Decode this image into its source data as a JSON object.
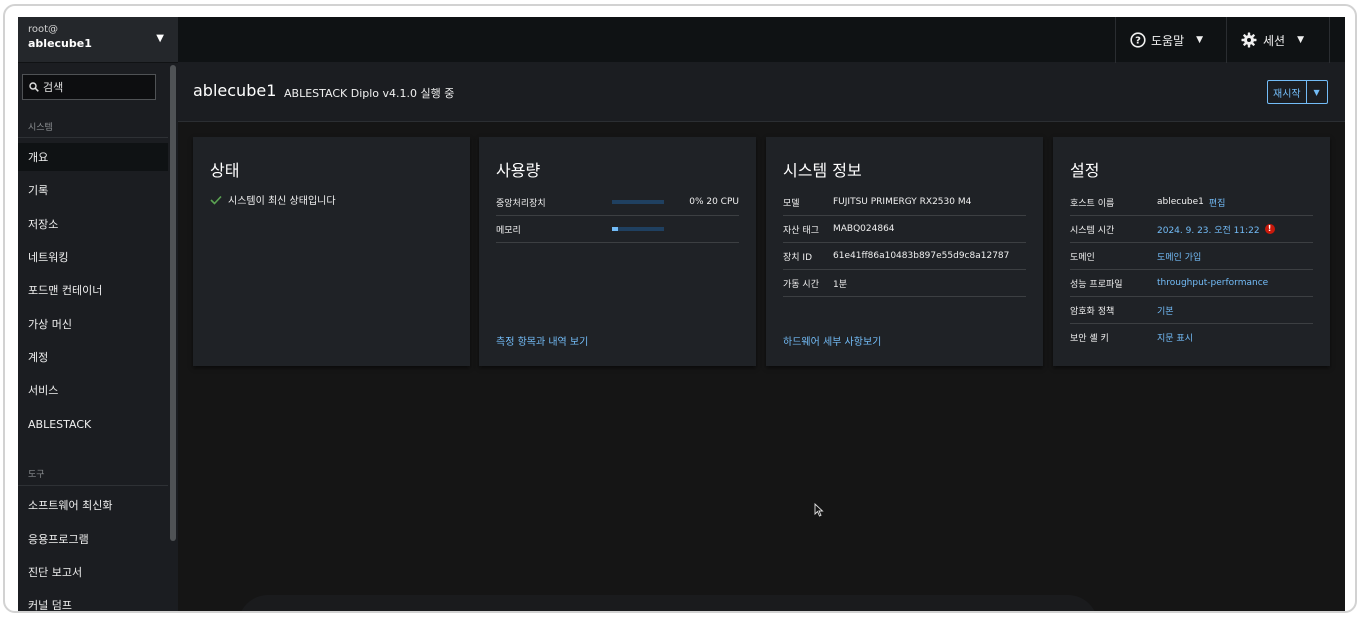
{
  "topbar": {
    "help_label": "도움말",
    "session_label": "세션"
  },
  "sidebar": {
    "user": "root@",
    "host": "ablecube1",
    "search_placeholder": "검색",
    "section_system": "시스템",
    "section_tools": "도구",
    "system_items": [
      "개요",
      "기록",
      "저장소",
      "네트워킹",
      "포드맨 컨테이너",
      "가상 머신",
      "계정",
      "서비스",
      "ABLESTACK"
    ],
    "tool_items": [
      "소프트웨어 최신화",
      "응용프로그램",
      "진단 보고서",
      "커널 덤프"
    ],
    "active_item": "개요"
  },
  "header": {
    "host": "ablecube1",
    "status": "ABLESTACK Diplo v4.1.0 실행 중",
    "restart_label": "재시작"
  },
  "cards": {
    "health": {
      "title": "상태",
      "message": "시스템이 최신 상태입니다"
    },
    "usage": {
      "title": "사용량",
      "rows": [
        {
          "label": "중앙처리장치",
          "value": "0% 20 CPU",
          "fraction": 0.0
        },
        {
          "label": "메모리",
          "value": "",
          "fraction": 0.12
        }
      ],
      "link": "측정 항목과 내역 보기"
    },
    "sysinfo": {
      "title": "시스템 정보",
      "rows": [
        {
          "key": "모델",
          "value": "FUJITSU PRIMERGY RX2530 M4"
        },
        {
          "key": "자산 태그",
          "value": "MABQ024864"
        },
        {
          "key": "장치 ID",
          "value": "61e41ff86a10483b897e55d9c8a12787"
        },
        {
          "key": "가동 시간",
          "value": "1분"
        }
      ],
      "link": "하드웨어 세부 사항보기"
    },
    "config": {
      "title": "설정",
      "rows": [
        {
          "key": "호스트 이름",
          "value": "ablecube1",
          "extra": "편집"
        },
        {
          "key": "시스템 시간",
          "value": "2024. 9. 23. 오전 11:22",
          "extra": "!"
        },
        {
          "key": "도메인",
          "value": "도메인 가입"
        },
        {
          "key": "성능 프로파일",
          "value": "throughput-performance"
        },
        {
          "key": "암호화 정책",
          "value": "기본"
        },
        {
          "key": "보안 셸 키",
          "value": "지문 표시"
        }
      ]
    }
  },
  "colors": {
    "accent": "#73bcf7",
    "success": "#5ba352",
    "danger": "#c9190b"
  }
}
